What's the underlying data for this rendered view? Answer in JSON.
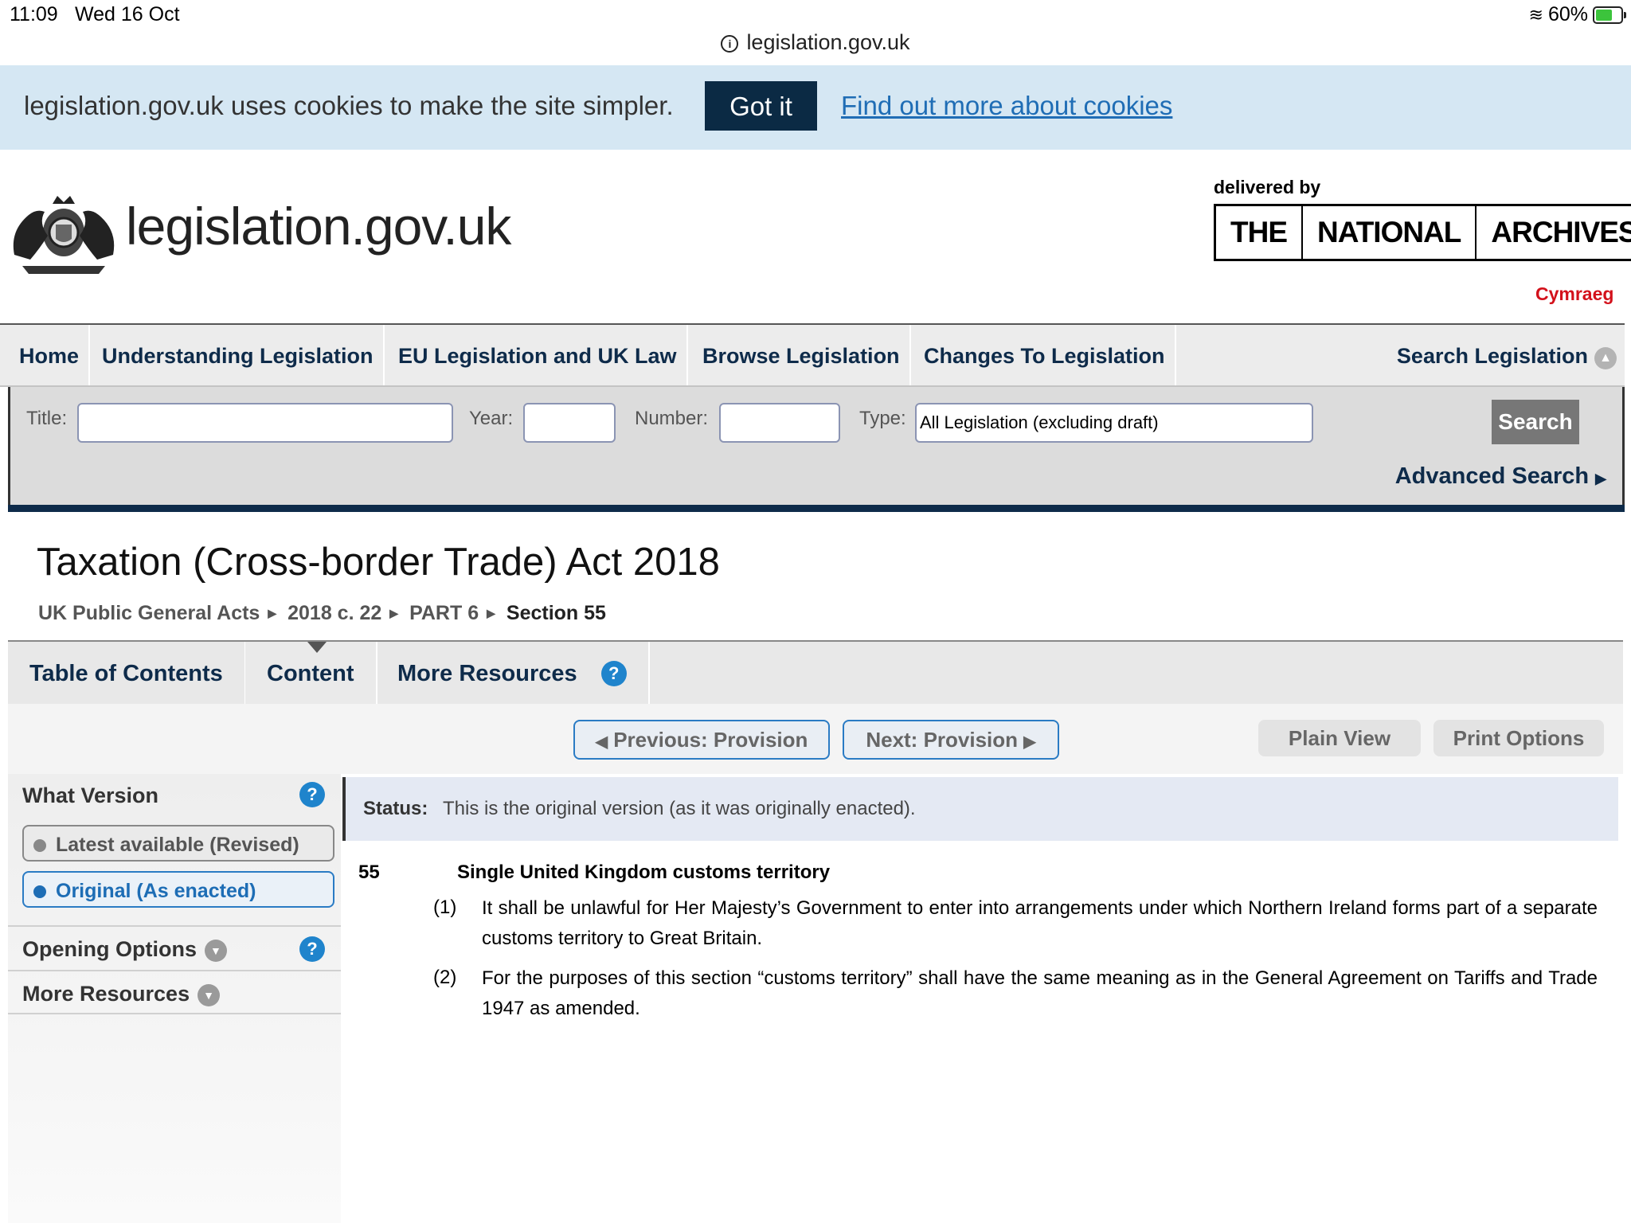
{
  "status_bar": {
    "time": "11:09",
    "date": "Wed 16 Oct",
    "battery": "60%",
    "url": "legislation.gov.uk"
  },
  "cookie_banner": {
    "text": "legislation.gov.uk uses cookies to make the site simpler.",
    "button": "Got it",
    "link": "Find out more about cookies"
  },
  "header": {
    "site_name": "legislation.gov.uk",
    "delivered_by": "delivered by",
    "tna_words": [
      "THE",
      "NATIONAL",
      "ARCHIVES"
    ],
    "language_link": "Cymraeg"
  },
  "main_nav": {
    "items": [
      "Home",
      "Understanding Legislation",
      "EU Legislation and UK Law",
      "Browse Legislation",
      "Changes To Legislation"
    ],
    "search_toggle": "Search Legislation"
  },
  "search": {
    "title_label": "Title:",
    "title_value": "",
    "year_label": "Year:",
    "year_value": "",
    "number_label": "Number:",
    "number_value": "",
    "type_label": "Type:",
    "type_value": "All Legislation (excluding draft)",
    "button": "Search",
    "advanced": "Advanced Search"
  },
  "document": {
    "title": "Taxation (Cross-border Trade) Act 2018",
    "breadcrumb": [
      "UK Public General Acts",
      "2018 c. 22",
      "PART 6",
      "Section 55"
    ]
  },
  "tabs": {
    "items": [
      "Table of Contents",
      "Content",
      "More Resources"
    ],
    "active": "Content"
  },
  "provision_nav": {
    "previous": "Previous: Provision",
    "next": "Next: Provision",
    "plain_view": "Plain View",
    "print_options": "Print Options"
  },
  "sidebar": {
    "what_version": "What Version",
    "versions": [
      "Latest available (Revised)",
      "Original (As enacted)"
    ],
    "selected_version": "Original (As enacted)",
    "opening_options": "Opening Options",
    "more_resources": "More Resources"
  },
  "content": {
    "status_label": "Status:",
    "status_text": "This is the original version (as it was originally enacted).",
    "section_number": "55",
    "section_title": "Single United Kingdom customs territory",
    "paragraphs": [
      {
        "num": "(1)",
        "text": "It shall be unlawful for Her Majesty’s Government to enter into arrangements under which Northern Ireland forms part of a separate customs territory to Great Britain."
      },
      {
        "num": "(2)",
        "text": "For the purposes of this section “customs territory” shall have the same meaning as in the General Agreement on Tariffs and Trade 1947 as amended."
      }
    ]
  },
  "colors": {
    "navy": "#0e2b4a",
    "link_blue": "#1f6db5",
    "cookie_bg": "#d5e7f3",
    "cymraeg_red": "#d3111b",
    "help_blue": "#1f84cc"
  }
}
